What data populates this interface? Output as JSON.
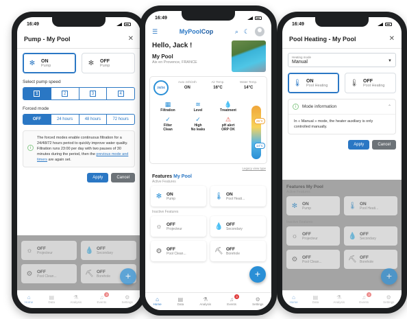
{
  "status_time": "16:49",
  "left": {
    "title": "Pump - My Pool",
    "on_label": "ON",
    "on_sub": "Pump",
    "off_label": "OFF",
    "off_sub": "Pump",
    "speed_label": "Select pump speed",
    "speeds": [
      "1",
      "2",
      "3",
      "4"
    ],
    "forced_label": "Forced mode",
    "forced_options": [
      "OFF",
      "24 hours",
      "48 hours",
      "72 hours"
    ],
    "info_text": "The forced modes enable continuous filtration for a 24/48/72 hours period to quickly improve water quality. Filtration runs 23:00 per day with two pauses of 30 minutes during the period, then the ",
    "info_link": "previous mode and timers",
    "info_tail": " are again set.",
    "apply": "Apply",
    "cancel": "Cancel",
    "bg_cards": [
      {
        "label": "OFF",
        "sub": "Projecteur"
      },
      {
        "label": "OFF",
        "sub": "Secondary"
      },
      {
        "label": "OFF",
        "sub": "Pool Clean..."
      },
      {
        "label": "OFF",
        "sub": "Borehole"
      }
    ]
  },
  "center": {
    "brand_a": "MyPool",
    "brand_b": "Cop",
    "greeting": "Hello, Jack !",
    "pool_name": "My Pool",
    "location": "Aix en Provence, FRANCE",
    "gauge_text": "24/24",
    "metrics": [
      {
        "title": "Auto 24h/24h",
        "value": "ON"
      },
      {
        "title": "Air Temp.",
        "value": "16°C"
      },
      {
        "title": "Water Temp.",
        "value": "14°C"
      }
    ],
    "states": [
      {
        "l1": "Filtration",
        "l2": ""
      },
      {
        "l1": "Level",
        "l2": ""
      },
      {
        "l1": "Treatment",
        "l2": ""
      },
      {
        "l1": "Filter",
        "l2": "Clean"
      },
      {
        "l1": "High",
        "l2": "No leaks"
      },
      {
        "l1": "pH alert",
        "l2": "ORP OK"
      }
    ],
    "temp_hot": "25°C",
    "temp_cold": "14°C",
    "legacy_link": "Legacy view type",
    "features_title_a": "Features",
    "features_title_b": " My Pool",
    "active_label": "Active Features",
    "active_cards": [
      {
        "label": "ON",
        "sub": "Pump"
      },
      {
        "label": "ON",
        "sub": "Pool Heati..."
      }
    ],
    "inactive_label": "Inactive Features",
    "inactive_cards": [
      {
        "label": "OFF",
        "sub": "Projecteur"
      },
      {
        "label": "OFF",
        "sub": "Secondary"
      },
      {
        "label": "OFF",
        "sub": "Pool Clean..."
      },
      {
        "label": "OFF",
        "sub": "Borehole"
      }
    ],
    "tabs": [
      {
        "label": "Home"
      },
      {
        "label": "Data"
      },
      {
        "label": "Analysis"
      },
      {
        "label": "Events",
        "badge": "3"
      },
      {
        "label": "Settings"
      }
    ]
  },
  "right": {
    "title": "Pool Heating - My Pool",
    "mode_label": "Heating mode",
    "mode_value": "Manual",
    "on_label": "ON",
    "on_sub": "Pool Heating",
    "off_label": "OFF",
    "off_sub": "Pool Heating",
    "info_title": "Mode information",
    "info_text": "In « Manual » mode, the heater auxiliary is only controlled manually.",
    "apply": "Apply",
    "cancel": "Cancel",
    "features_title": "Features My Pool",
    "active_label": "Active Features",
    "bg_active": [
      {
        "label": "ON",
        "sub": "Pump"
      },
      {
        "label": "ON",
        "sub": "Pool Heati..."
      }
    ],
    "inactive_label": "Inactive Features",
    "bg_inactive": [
      {
        "label": "OFF",
        "sub": "Projecteur"
      },
      {
        "label": "OFF",
        "sub": "Secondary"
      },
      {
        "label": "OFF",
        "sub": "Pool Clean..."
      },
      {
        "label": "OFF",
        "sub": "Borehole"
      }
    ]
  },
  "colors": {
    "primary": "#2a77c4",
    "accent": "#2a8fd6",
    "warning": "#e04a3a",
    "badge": "#e03a3a"
  }
}
